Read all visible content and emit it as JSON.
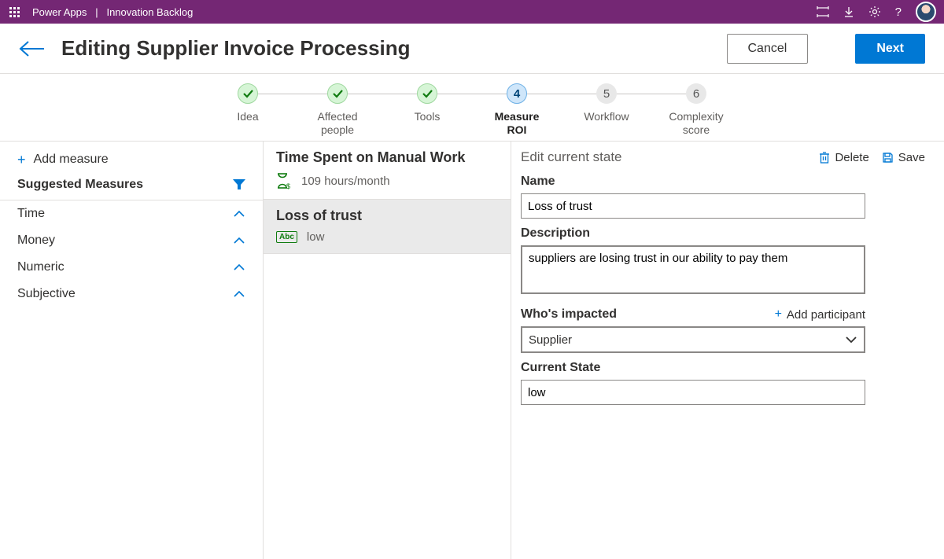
{
  "topbar": {
    "app_name": "Power Apps",
    "separator": "|",
    "context": "Innovation Backlog"
  },
  "header": {
    "title": "Editing Supplier Invoice Processing",
    "cancel": "Cancel",
    "next": "Next"
  },
  "stepper": [
    {
      "label": "Idea",
      "status": "done"
    },
    {
      "label": "Affected people",
      "status": "done"
    },
    {
      "label": "Tools",
      "status": "done"
    },
    {
      "label": "Measure ROI",
      "status": "current",
      "num": "4"
    },
    {
      "label": "Workflow",
      "status": "pending",
      "num": "5"
    },
    {
      "label": "Complexity score",
      "status": "pending",
      "num": "6"
    }
  ],
  "sidebar": {
    "add_measure": "Add measure",
    "suggested_title": "Suggested Measures",
    "categories": [
      "Time",
      "Money",
      "Numeric",
      "Subjective"
    ]
  },
  "measures": [
    {
      "title": "Time Spent on Manual Work",
      "value": "109 hours/month",
      "icon": "hourglass"
    },
    {
      "title": "Loss of trust",
      "value": "low",
      "icon": "abc"
    }
  ],
  "editor": {
    "heading": "Edit current state",
    "delete": "Delete",
    "save": "Save",
    "labels": {
      "name": "Name",
      "description": "Description",
      "impacted": "Who's impacted",
      "current_state": "Current State"
    },
    "add_participant": "Add participant",
    "values": {
      "name": "Loss of trust",
      "description": "suppliers are losing trust in our ability to pay them",
      "impacted": "Supplier",
      "current_state": "low"
    }
  }
}
